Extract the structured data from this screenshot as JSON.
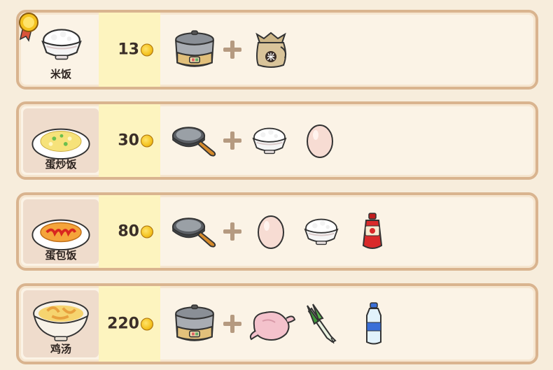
{
  "recipes": [
    {
      "name": "米饭",
      "price": "13",
      "dish_icon": "rice-bowl-icon",
      "ingredients": [
        "rice-cooker-icon",
        "rice-sack-icon"
      ],
      "sack_label": "米"
    },
    {
      "name": "蛋炒饭",
      "price": "30",
      "dish_icon": "fried-rice-icon",
      "ingredients": [
        "frying-pan-icon",
        "rice-bowl-icon",
        "egg-icon"
      ]
    },
    {
      "name": "蛋包饭",
      "price": "80",
      "dish_icon": "omurice-icon",
      "ingredients": [
        "frying-pan-icon",
        "egg-icon",
        "rice-bowl-icon",
        "ketchup-icon"
      ]
    },
    {
      "name": "鸡汤",
      "price": "220",
      "dish_icon": "chicken-soup-icon",
      "ingredients": [
        "rice-cooker-icon",
        "raw-chicken-icon",
        "green-onion-icon",
        "water-bottle-icon"
      ]
    }
  ],
  "colors": {
    "background": "#f7eddc",
    "row_border": "#d9b48f",
    "price_bg": "#fdf4bf",
    "coin": "#f4c21f"
  }
}
